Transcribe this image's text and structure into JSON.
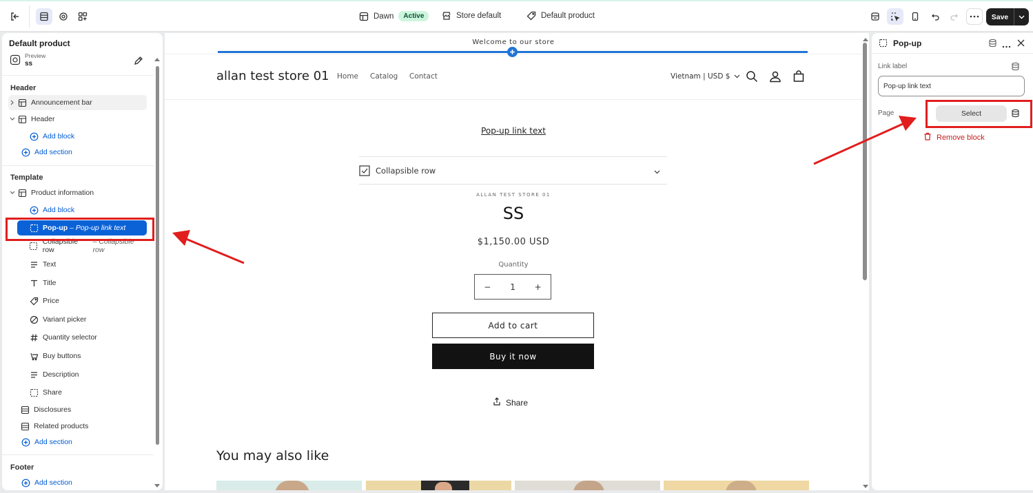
{
  "topbar": {
    "theme_name": "Dawn",
    "theme_status": "Active",
    "market": "Store default",
    "template": "Default product",
    "save_label": "Save"
  },
  "sidebar": {
    "title": "Default product",
    "preview_label": "Preview",
    "preview_value": "ss",
    "header_group": "Header",
    "header_items": [
      {
        "label": "Announcement bar"
      },
      {
        "label": "Header"
      },
      {
        "label": "Add block"
      },
      {
        "label": "Add section"
      }
    ],
    "template_group": "Template",
    "template_items": [
      {
        "label": "Product information"
      },
      {
        "label": "Add block"
      },
      {
        "label": "Pop-up",
        "secondary": "– Pop-up link text"
      },
      {
        "label": "Collapsible row",
        "secondary": "– Collapsible row"
      },
      {
        "label": "Text"
      },
      {
        "label": "Title"
      },
      {
        "label": "Price"
      },
      {
        "label": "Variant picker"
      },
      {
        "label": "Quantity selector"
      },
      {
        "label": "Buy buttons"
      },
      {
        "label": "Description"
      },
      {
        "label": "Share"
      },
      {
        "label": "Disclosures"
      },
      {
        "label": "Related products"
      },
      {
        "label": "Add section"
      }
    ],
    "footer_group": "Footer",
    "footer_items": [
      {
        "label": "Add section"
      }
    ]
  },
  "preview": {
    "announcement": "Welcome to our store",
    "store_name": "allan test store 01",
    "nav": [
      "Home",
      "Catalog",
      "Contact"
    ],
    "country": "Vietnam | USD $",
    "popup_link": "Pop-up link text",
    "collapsible_row": "Collapsible row",
    "vendor": "ALLAN TEST STORE 01",
    "product_title": "SS",
    "price": "$1,150.00 USD",
    "quantity_label": "Quantity",
    "quantity_value": "1",
    "qty_minus": "−",
    "qty_plus": "+",
    "add_to_cart": "Add to cart",
    "buy_now": "Buy it now",
    "share": "Share",
    "also_like": "You may also like"
  },
  "right_panel": {
    "title": "Pop-up",
    "link_label_title": "Link label",
    "link_label_value": "Pop-up link text",
    "page_label": "Page",
    "select_label": "Select",
    "remove_label": "Remove block"
  },
  "colors": {
    "accent_blue": "#0b62d6",
    "highlight_red": "#e11d1d",
    "active_badge": "#cdf5de",
    "remove_red": "#c51e1e"
  }
}
